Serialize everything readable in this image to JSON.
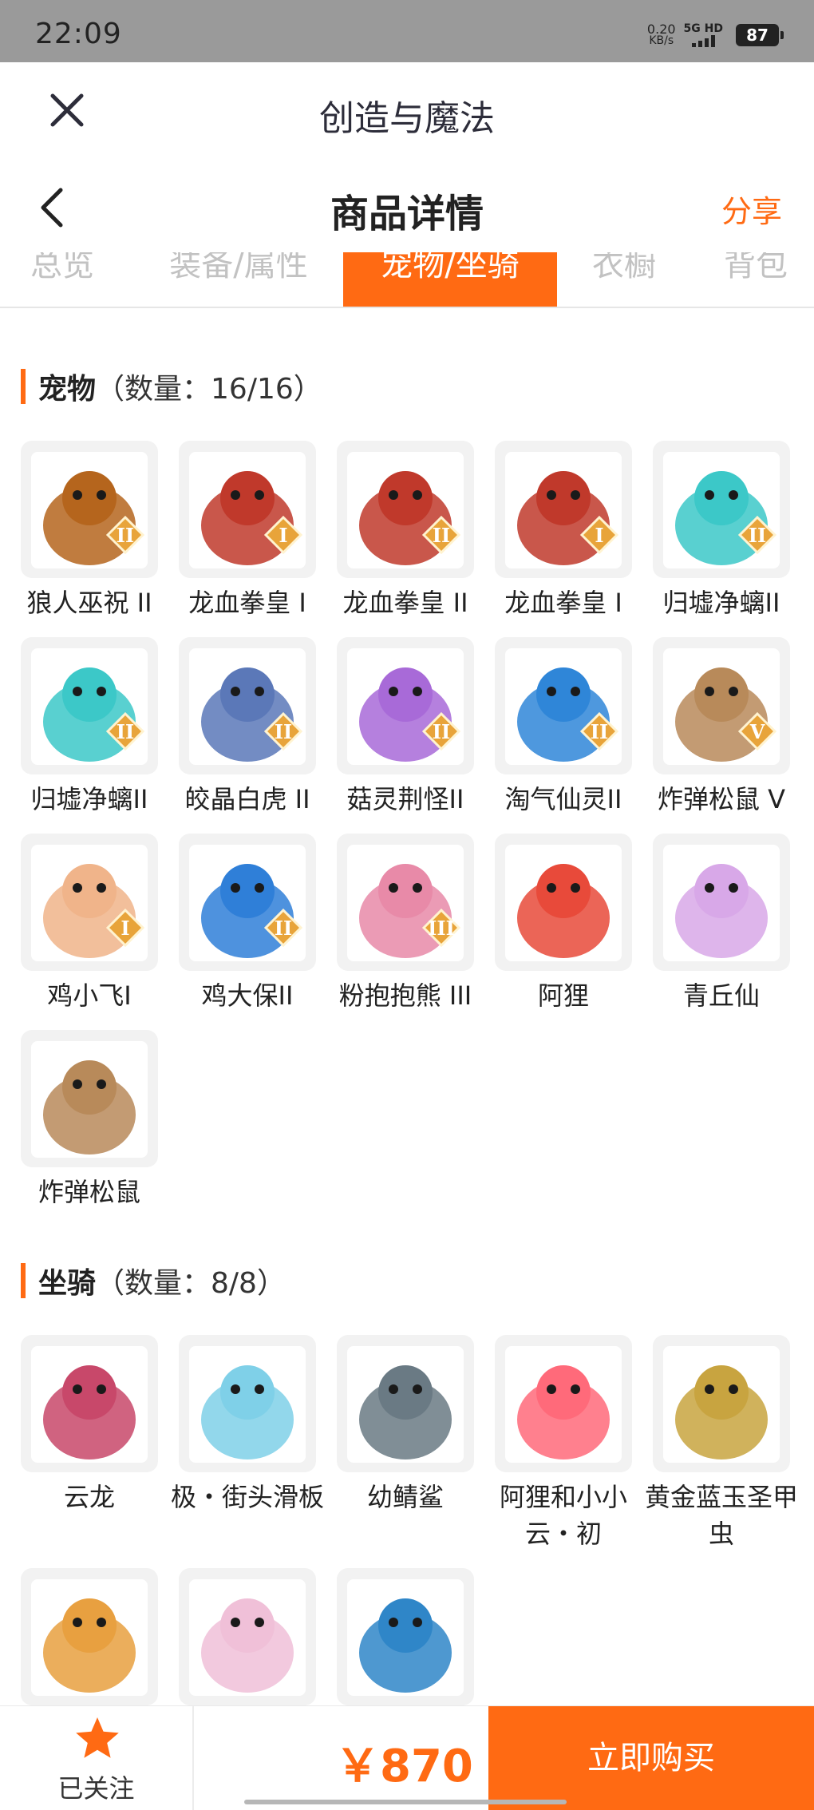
{
  "status_bar": {
    "time": "22:09",
    "net_speed": "0.20",
    "net_unit": "KB/s",
    "network": "5G HD",
    "battery": "87"
  },
  "app_header": {
    "title": "创造与魔法"
  },
  "nav": {
    "title": "商品详情",
    "share": "分享"
  },
  "tabs": [
    {
      "label": "总览"
    },
    {
      "label": "装备/属性"
    },
    {
      "label": "宠物/坐骑",
      "active": true
    },
    {
      "label": "衣橱"
    },
    {
      "label": "背包"
    }
  ],
  "pets": {
    "name": "宠物",
    "count": "（数量：16/16）",
    "items": [
      {
        "label": "狼人巫祝 II",
        "badge": "II",
        "color": "#b5651d"
      },
      {
        "label": "龙血拳皇 I",
        "badge": "I",
        "color": "#c0392b"
      },
      {
        "label": "龙血拳皇 II",
        "badge": "II",
        "color": "#c0392b"
      },
      {
        "label": "龙血拳皇 I",
        "badge": "I",
        "color": "#c0392b"
      },
      {
        "label": "归墟净螭II",
        "badge": "II",
        "color": "#3cc8c8"
      },
      {
        "label": "归墟净螭II",
        "badge": "II",
        "color": "#3cc8c8"
      },
      {
        "label": "皎晶白虎 II",
        "badge": "II",
        "color": "#5b78b8"
      },
      {
        "label": "菇灵荆怪II",
        "badge": "II",
        "color": "#a86ad8"
      },
      {
        "label": "淘气仙灵II",
        "badge": "II",
        "color": "#2f86d8"
      },
      {
        "label": "炸弹松鼠 V",
        "badge": "V",
        "color": "#b88a5a"
      },
      {
        "label": "鸡小飞I",
        "badge": "I",
        "color": "#f0b48a"
      },
      {
        "label": "鸡大保II",
        "badge": "II",
        "color": "#2f7fd8"
      },
      {
        "label": "粉抱抱熊 III",
        "badge": "III",
        "color": "#e88aa8"
      },
      {
        "label": "阿狸",
        "badge": "",
        "color": "#e84a3a"
      },
      {
        "label": "青丘仙",
        "badge": "",
        "color": "#d8a8e8"
      },
      {
        "label": "炸弹松鼠",
        "badge": "",
        "color": "#b88a5a"
      }
    ]
  },
  "mounts": {
    "name": "坐骑",
    "count": "（数量：8/8）",
    "items": [
      {
        "label": "云龙",
        "color": "#c8486a"
      },
      {
        "label": "极・街头滑板",
        "color": "#7fd0e8"
      },
      {
        "label": "幼鲭鲨",
        "color": "#6a7a84"
      },
      {
        "label": "阿狸和小小云・初",
        "color": "#ff6a7a"
      },
      {
        "label": "黄金蓝玉圣甲虫",
        "color": "#c8a440"
      },
      {
        "label": "",
        "color": "#e8a040"
      },
      {
        "label": "",
        "color": "#f0c0d8"
      },
      {
        "label": "",
        "color": "#2f86c8"
      }
    ]
  },
  "bottom_bar": {
    "follow_label": "已关注",
    "price": "￥870",
    "buy_label": "立即购买"
  }
}
